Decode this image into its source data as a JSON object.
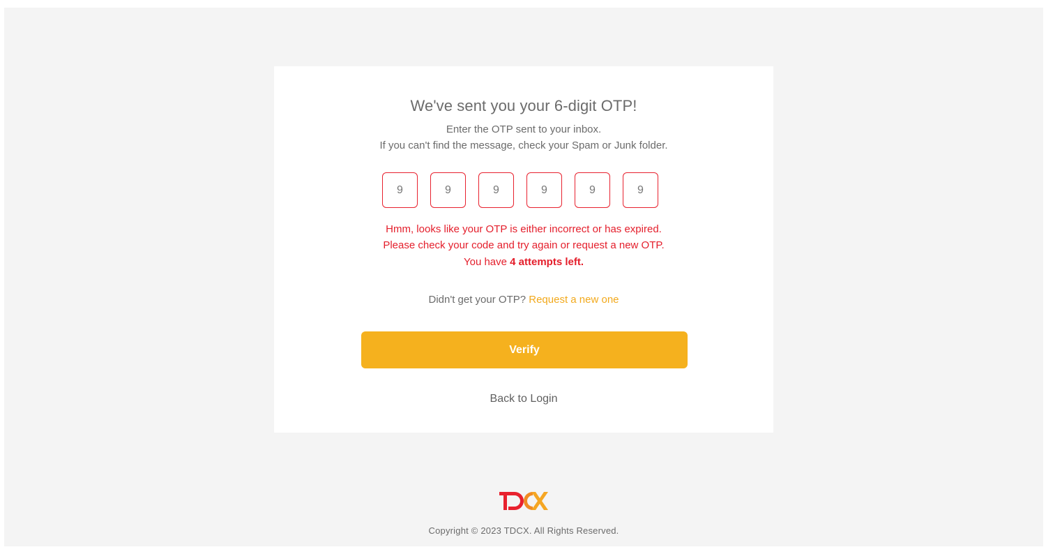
{
  "otp_card": {
    "title": "We've sent you your 6-digit OTP!",
    "subtitle_line1": "Enter the OTP sent to your inbox.",
    "subtitle_line2": "If you can't find the message, check your Spam or Junk folder.",
    "otp_digits": [
      "9",
      "9",
      "9",
      "9",
      "9",
      "9"
    ],
    "error_line1": "Hmm, looks like your OTP is either incorrect or has expired.",
    "error_line2": "Please check your code and try again or request a new OTP.",
    "error_line3_prefix": "You have ",
    "error_line3_bold": "4 attempts left.",
    "resend_prompt": "Didn't get your OTP? ",
    "resend_link": "Request a new one",
    "verify_label": "Verify",
    "back_label": "Back to Login"
  },
  "footer": {
    "logo_text": "TDCX",
    "copyright": "Copyright © 2023 TDCX. All Rights Reserved."
  },
  "colors": {
    "accent": "#f5b11e",
    "error": "#e41e2b",
    "link": "#f2a91c",
    "logo_red": "#e8212e",
    "logo_orange": "#f5a623"
  }
}
